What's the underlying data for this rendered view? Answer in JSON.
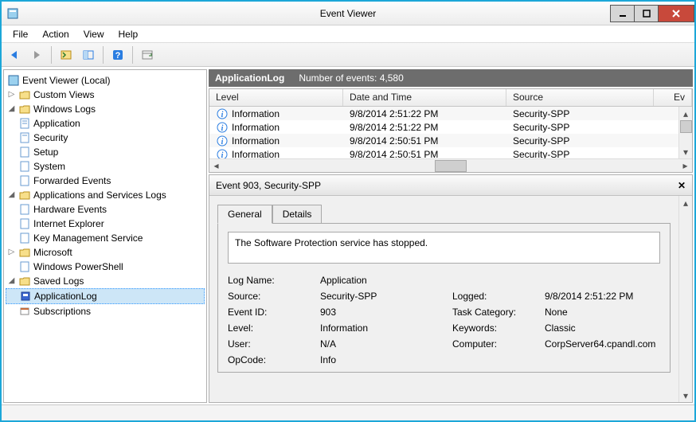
{
  "window": {
    "title": "Event Viewer"
  },
  "menu": {
    "file": "File",
    "action": "Action",
    "view": "View",
    "help": "Help"
  },
  "tree": {
    "root": "Event Viewer (Local)",
    "custom_views": "Custom Views",
    "windows_logs": "Windows Logs",
    "wl": {
      "application": "Application",
      "security": "Security",
      "setup": "Setup",
      "system": "System",
      "forwarded": "Forwarded Events"
    },
    "apps_services": "Applications and Services Logs",
    "as": {
      "hardware": "Hardware Events",
      "ie": "Internet Explorer",
      "kms": "Key Management Service",
      "microsoft": "Microsoft",
      "wps": "Windows PowerShell"
    },
    "saved_logs": "Saved Logs",
    "saved_item": "ApplicationLog",
    "subscriptions": "Subscriptions"
  },
  "log_header": {
    "name": "ApplicationLog",
    "count_label": "Number of events: 4,580"
  },
  "grid": {
    "cols": {
      "level": "Level",
      "date": "Date and Time",
      "source": "Source",
      "ev": "Ev"
    },
    "rows": [
      {
        "level": "Information",
        "date": "9/8/2014 2:51:22 PM",
        "source": "Security-SPP"
      },
      {
        "level": "Information",
        "date": "9/8/2014 2:51:22 PM",
        "source": "Security-SPP"
      },
      {
        "level": "Information",
        "date": "9/8/2014 2:50:51 PM",
        "source": "Security-SPP"
      },
      {
        "level": "Information",
        "date": "9/8/2014 2:50:51 PM",
        "source": "Security-SPP"
      }
    ]
  },
  "detail": {
    "title": "Event 903, Security-SPP",
    "tabs": {
      "general": "General",
      "details": "Details"
    },
    "message": "The Software Protection service has stopped.",
    "labels": {
      "log_name": "Log Name:",
      "source": "Source:",
      "event_id": "Event ID:",
      "level": "Level:",
      "user": "User:",
      "opcode": "OpCode:",
      "logged": "Logged:",
      "task": "Task Category:",
      "keywords": "Keywords:",
      "computer": "Computer:"
    },
    "values": {
      "log_name": "Application",
      "source": "Security-SPP",
      "event_id": "903",
      "level": "Information",
      "user": "N/A",
      "opcode": "Info",
      "logged": "9/8/2014 2:51:22 PM",
      "task": "None",
      "keywords": "Classic",
      "computer": "CorpServer64.cpandl.com"
    }
  }
}
